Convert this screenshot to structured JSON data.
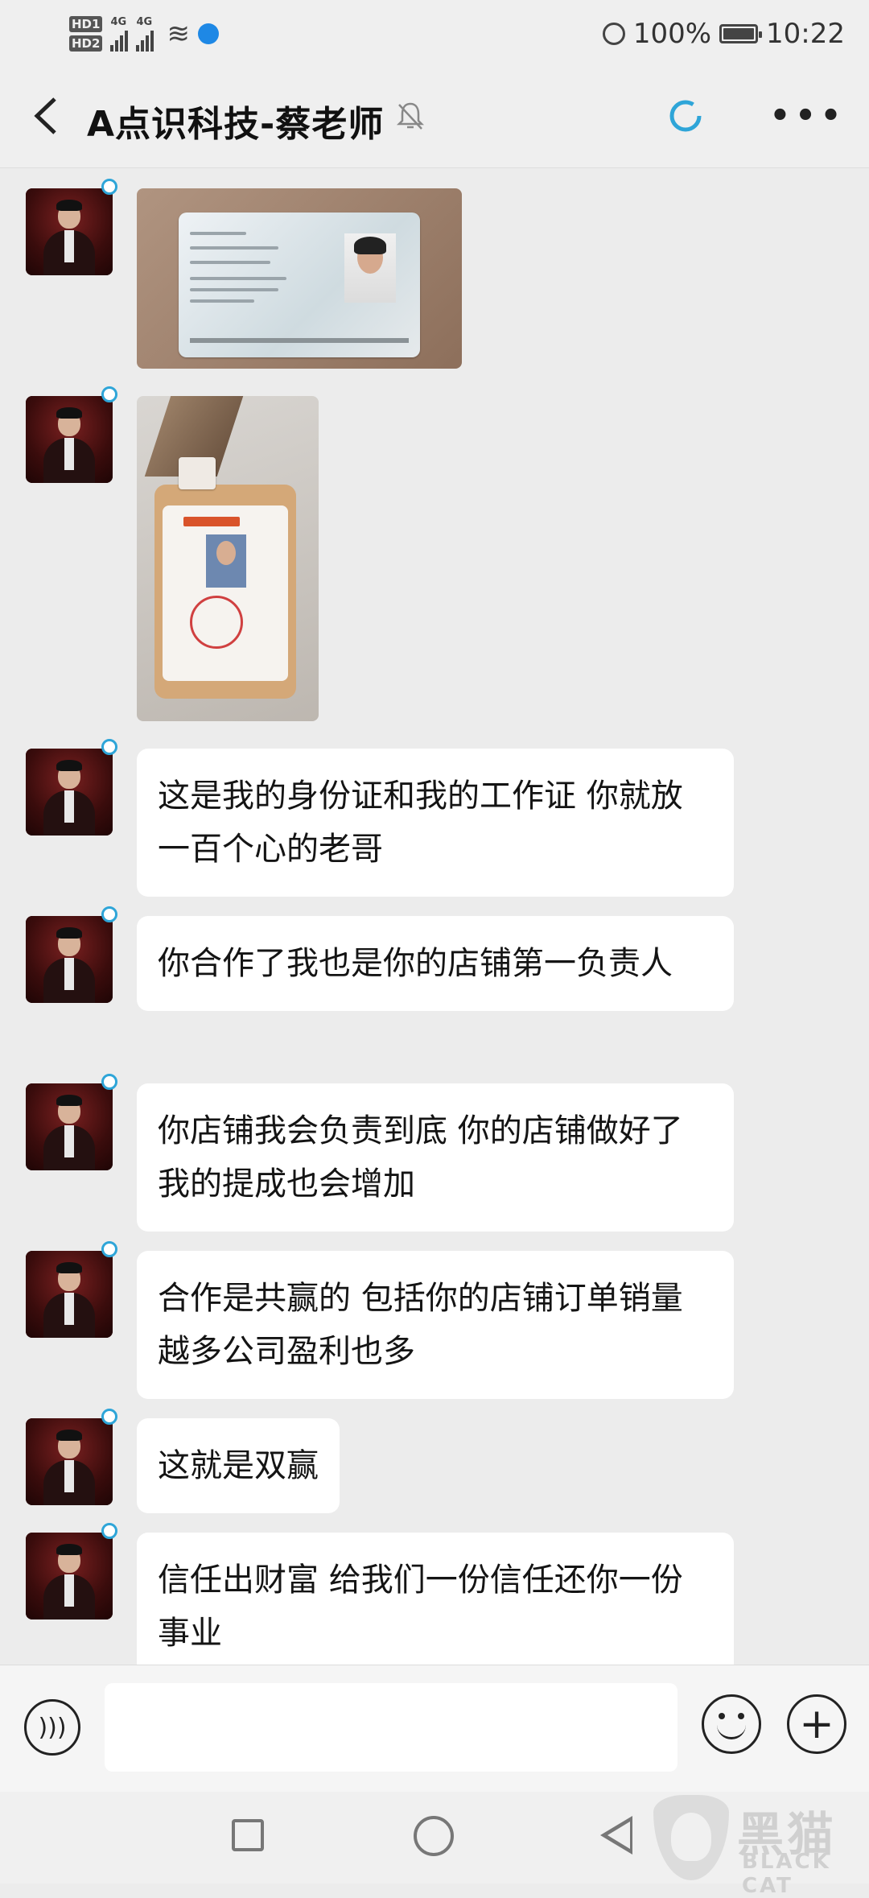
{
  "status_bar": {
    "hd1": "HD1",
    "hd2": "HD2",
    "network1": "4G",
    "network2": "4G",
    "battery": "100%",
    "time": "10:22"
  },
  "header": {
    "title": "A点识科技-蔡老师",
    "icons": [
      "back-arrow",
      "muted-bell",
      "sync-spinner",
      "more-menu"
    ]
  },
  "messages": [
    {
      "type": "image",
      "content": "ID card photo"
    },
    {
      "type": "image",
      "content": "work badge photo"
    },
    {
      "type": "text",
      "text": "这是我的身份证和我的工作证 你就放一百个心的老哥"
    },
    {
      "type": "text",
      "text": "你合作了我也是你的店铺第一负责人"
    },
    {
      "type": "text",
      "text": "你店铺我会负责到底 你的店铺做好了我的提成也会增加"
    },
    {
      "type": "text",
      "text": "合作是共赢的 包括你的店铺订单销量越多公司盈利也多"
    },
    {
      "type": "text",
      "text": "这就是双赢"
    },
    {
      "type": "text",
      "text": "信任出财富 给我们一份信任还你一份事业"
    }
  ],
  "input": {
    "value": "",
    "placeholder": ""
  },
  "watermark": {
    "cn": "黑猫",
    "en": "BLACK CAT"
  },
  "colors": {
    "background": "#ececec",
    "bubble": "#ffffff",
    "accent": "#2ea5d8"
  }
}
